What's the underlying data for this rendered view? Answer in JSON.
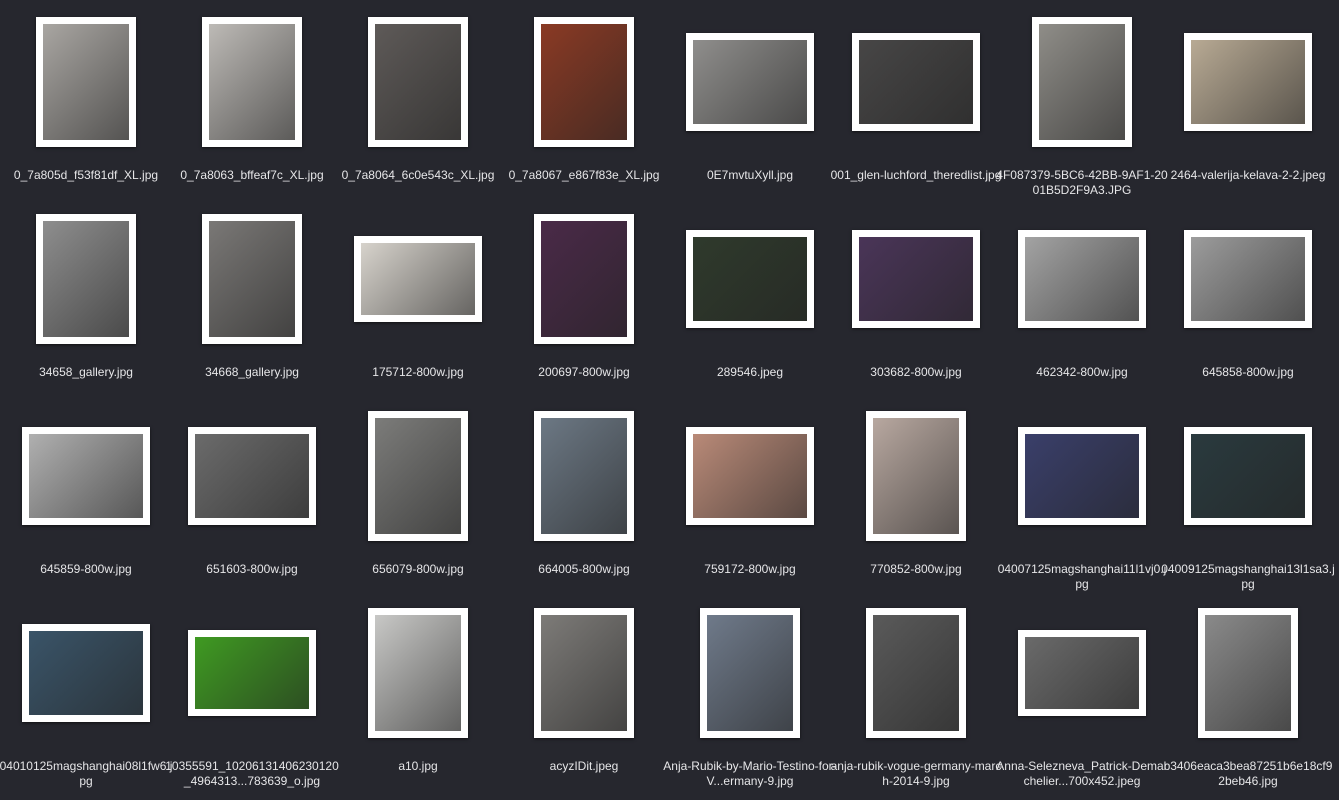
{
  "window": {
    "background": "#26272e"
  },
  "files": [
    {
      "name": "0_7a805d_f53f81df_XL.jpg",
      "thumb_color": "#a9a6a2",
      "aspect": "portrait"
    },
    {
      "name": "0_7a8063_bffeaf7c_XL.jpg",
      "thumb_color": "#bdbab6",
      "aspect": "portrait"
    },
    {
      "name": "0_7a8064_6c0e543c_XL.jpg",
      "thumb_color": "#5e5a58",
      "aspect": "portrait"
    },
    {
      "name": "0_7a8067_e867f83e_XL.jpg",
      "thumb_color": "#8a3a24",
      "aspect": "portrait"
    },
    {
      "name": "0E7mvtuXyll.jpg",
      "thumb_color": "#8f8e8c",
      "aspect": "landscape"
    },
    {
      "name": "001_glen-luchford_theredlist.jpg",
      "thumb_color": "#474646",
      "aspect": "landscape"
    },
    {
      "name": "4F087379-5BC6-42BB-9AF1-2001B5D2F9A3.JPG",
      "thumb_color": "#8f8d88",
      "aspect": "portrait"
    },
    {
      "name": "2464-valerija-kelava-2-2.jpeg",
      "thumb_color": "#b8aa94",
      "aspect": "landscape"
    },
    {
      "name": "34658_gallery.jpg",
      "thumb_color": "#8e8e8e",
      "aspect": "portrait"
    },
    {
      "name": "34668_gallery.jpg",
      "thumb_color": "#7a7876",
      "aspect": "portrait"
    },
    {
      "name": "175712-800w.jpg",
      "thumb_color": "#d7d3cc",
      "aspect": "wide"
    },
    {
      "name": "200697-800w.jpg",
      "thumb_color": "#4a2a48",
      "aspect": "portrait"
    },
    {
      "name": "289546.jpeg",
      "thumb_color": "#2f3a2c",
      "aspect": "landscape"
    },
    {
      "name": "303682-800w.jpg",
      "thumb_color": "#4a3558",
      "aspect": "landscape"
    },
    {
      "name": "462342-800w.jpg",
      "thumb_color": "#a3a3a3",
      "aspect": "landscape"
    },
    {
      "name": "645858-800w.jpg",
      "thumb_color": "#9c9c9c",
      "aspect": "landscape"
    },
    {
      "name": "645859-800w.jpg",
      "thumb_color": "#b0b0b0",
      "aspect": "landscape"
    },
    {
      "name": "651603-800w.jpg",
      "thumb_color": "#6b6b6b",
      "aspect": "landscape"
    },
    {
      "name": "656079-800w.jpg",
      "thumb_color": "#7c7c7a",
      "aspect": "portrait"
    },
    {
      "name": "664005-800w.jpg",
      "thumb_color": "#6c7884",
      "aspect": "portrait"
    },
    {
      "name": "759172-800w.jpg",
      "thumb_color": "#b98a78",
      "aspect": "landscape"
    },
    {
      "name": "770852-800w.jpg",
      "thumb_color": "#b8a8a0",
      "aspect": "portrait"
    },
    {
      "name": "04007125magshanghai11l1vj0.jpg",
      "thumb_color": "#3a3f6a",
      "aspect": "landscape"
    },
    {
      "name": "04009125magshanghai13l1sa3.jpg",
      "thumb_color": "#2a3a3e",
      "aspect": "landscape"
    },
    {
      "name": "04010125magshanghai08l1fw6.jpg",
      "thumb_color": "#3a5468",
      "aspect": "landscape"
    },
    {
      "name": "10355591_10206131406230120_4964313...783639_o.jpg",
      "thumb_color": "#3f9a22",
      "aspect": "wide"
    },
    {
      "name": "a10.jpg",
      "thumb_color": "#c8c8c6",
      "aspect": "portrait"
    },
    {
      "name": "acyzIDit.jpeg",
      "thumb_color": "#7d7b78",
      "aspect": "portrait"
    },
    {
      "name": "Anja-Rubik-by-Mario-Testino-for-V...ermany-9.jpg",
      "thumb_color": "#6f7a8a",
      "aspect": "portrait"
    },
    {
      "name": "anja-rubik-vogue-germany-march-2014-9.jpg",
      "thumb_color": "#5a5a5a",
      "aspect": "portrait"
    },
    {
      "name": "Anna-Selezneva_Patrick-Demarchelier...700x452.jpeg",
      "thumb_color": "#6a6a6a",
      "aspect": "wide"
    },
    {
      "name": "b3406eaca3bea87251b6e18cf92beb46.jpg",
      "thumb_color": "#8a8a8a",
      "aspect": "portrait"
    }
  ]
}
